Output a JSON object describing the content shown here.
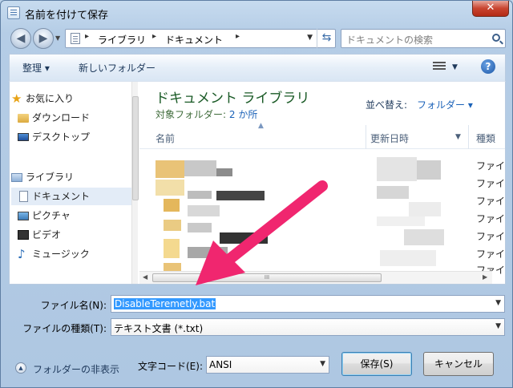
{
  "window": {
    "title": "名前を付けて保存",
    "close_label": "✕"
  },
  "address": {
    "crumbs": [
      "ライブラリ",
      "ドキュメント"
    ],
    "search_placeholder": "ドキュメントの検索"
  },
  "toolbar": {
    "organize_label": "整理 ▾",
    "new_folder_label": "新しいフォルダー"
  },
  "sidebar": {
    "items": [
      {
        "label": "お気に入り",
        "icon": "star-icon"
      },
      {
        "label": "ダウンロード",
        "icon": "folder-icon"
      },
      {
        "label": "デスクトップ",
        "icon": "desktop-icon"
      },
      {
        "label": "ライブラリ",
        "icon": "library-icon"
      },
      {
        "label": "ドキュメント",
        "icon": "document-icon"
      },
      {
        "label": "ピクチャ",
        "icon": "picture-icon"
      },
      {
        "label": "ビデオ",
        "icon": "video-icon"
      },
      {
        "label": "ミュージック",
        "icon": "music-icon"
      }
    ]
  },
  "library": {
    "title": "ドキュメント ライブラリ",
    "subtitle_prefix": "対象フォルダー:",
    "subtitle_link": "2 か所",
    "sort_label": "並べ替え:",
    "sort_value": "フォルダー ▾"
  },
  "columns": {
    "name": "名前",
    "date": "更新日時",
    "type": "種類"
  },
  "rows_type": [
    "ファイ",
    "ファイ",
    "ファイ",
    "ファイ",
    "ファイ",
    "ファイ",
    "ファイ"
  ],
  "form": {
    "filename_label": "ファイル名(N):",
    "filename_value": "DisableTeremetly.bat",
    "filetype_label": "ファイルの種類(T):",
    "filetype_value": "テキスト文書 (*.txt)",
    "encoding_label": "文字コード(E):",
    "encoding_value": "ANSI",
    "hide_folders_label": "フォルダーの非表示",
    "save_label": "保存(S)",
    "cancel_label": "キャンセル"
  },
  "colors": {
    "annotation_arrow": "#f0266f",
    "selection": "#3399ff"
  }
}
